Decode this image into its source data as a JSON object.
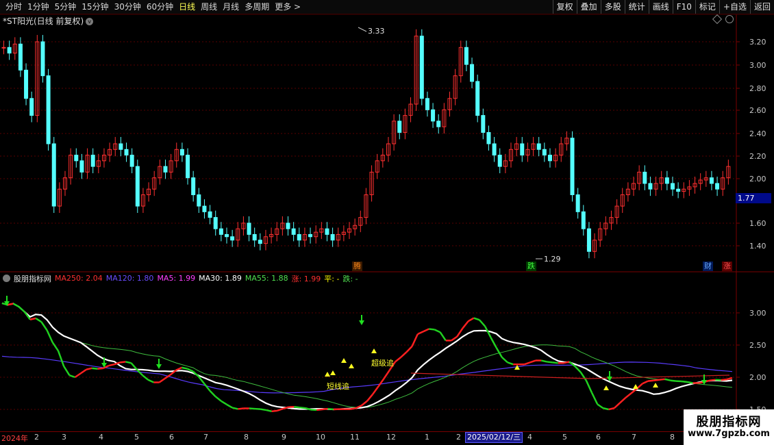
{
  "toolbar": {
    "periods": [
      "分时",
      "1分钟",
      "5分钟",
      "15分钟",
      "30分钟",
      "60分钟",
      "日线",
      "周线",
      "月线",
      "多周期",
      "更多 >"
    ],
    "active_period": "日线",
    "right_buttons": [
      "复权",
      "叠加",
      "多股",
      "统计",
      "画线",
      "F10",
      "标记",
      "+自选",
      "返回"
    ]
  },
  "stock": {
    "title": "*ST阳光(日线 前复权)",
    "current_price": "1.77",
    "high_label": "3.33",
    "low_label": "1.29"
  },
  "price_axis": [
    "3.20",
    "3.00",
    "2.80",
    "2.60",
    "2.40",
    "2.20",
    "2.00",
    "1.60",
    "1.40"
  ],
  "indicator_axis": [
    "3.00",
    "2.50",
    "2.00",
    "1.50"
  ],
  "event_tags": [
    {
      "text": "腾",
      "color": "#ff6a00"
    },
    {
      "text": "跌",
      "color": "#00c000"
    },
    {
      "text": "财",
      "color": "#1e6fff"
    },
    {
      "text": "涨",
      "color": "#ff2020"
    }
  ],
  "indicator": {
    "name": "股朋指标网",
    "items": [
      {
        "label": "MA250: 2.04",
        "color": "#ff3030"
      },
      {
        "label": "MA120: 1.80",
        "color": "#6a4cff"
      },
      {
        "label": "MA5: 1.99",
        "color": "#ff40ff"
      },
      {
        "label": "MA30: 1.89",
        "color": "#ffffff"
      },
      {
        "label": "MA55: 1.88",
        "color": "#50e050"
      },
      {
        "label": "涨: 1.99",
        "color": "#ff3030"
      },
      {
        "label": "平: -",
        "color": "#ffff00"
      },
      {
        "label": "跌: -",
        "color": "#50e050"
      }
    ],
    "annotations": [
      "短线追",
      "超级追"
    ]
  },
  "date_axis": {
    "labels": [
      "2024年",
      "2",
      "3",
      "4",
      "5",
      "6",
      "7",
      "8",
      "9",
      "10",
      "11",
      "12",
      "1",
      "2",
      "4",
      "5",
      "6",
      "7",
      "8"
    ],
    "cursor_date": "2025/02/12/三"
  },
  "watermark": {
    "title": "股朋指标网",
    "url": "www.7gpzb.com"
  }
}
